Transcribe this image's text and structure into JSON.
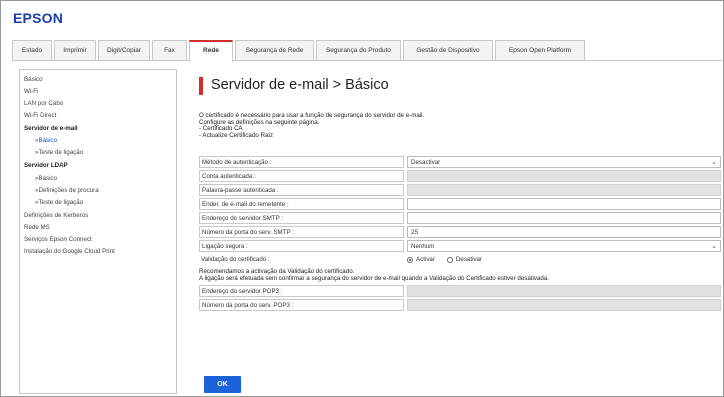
{
  "brand": {
    "logo": "EPSON"
  },
  "tabs": [
    {
      "label": "Estado"
    },
    {
      "label": "Imprimir"
    },
    {
      "label": "Digit/Copiar"
    },
    {
      "label": "Fax"
    },
    {
      "label": "Rede"
    },
    {
      "label": "Segurança de Rede"
    },
    {
      "label": "Segurança do Produto"
    },
    {
      "label": "Gestão de Dispositivo"
    },
    {
      "label": "Epson Open Platform"
    }
  ],
  "sidebar": {
    "items": [
      {
        "label": "Básico"
      },
      {
        "label": "Wi-Fi"
      },
      {
        "label": "LAN por Cabo"
      },
      {
        "label": "Wi-Fi Direct"
      },
      {
        "label": "Servidor de e-mail"
      },
      {
        "label": "»Básico"
      },
      {
        "label": "»Teste de ligação"
      },
      {
        "label": "Servidor LDAP"
      },
      {
        "label": "»Básico"
      },
      {
        "label": "»Definições de procura"
      },
      {
        "label": "»Teste de ligação"
      },
      {
        "label": "Definições de Kerberos"
      },
      {
        "label": "Rede MS"
      },
      {
        "label": "Serviços Epson Connect"
      },
      {
        "label": "Instalação do Google Cloud Print"
      }
    ]
  },
  "page": {
    "title": "Servidor de e-mail > Básico",
    "info_lines": [
      "O certificado é necessário para usar a função de segurança do servidor de e-mail.",
      "Configure as definições na seguinte página.",
      " - Certificado CA",
      " - Actualize Certificado Raiz"
    ]
  },
  "form": {
    "auth_method": {
      "label": "Método de autenticação :",
      "value": "Desactivar"
    },
    "auth_account": {
      "label": "Conta autenticada :",
      "value": ""
    },
    "auth_password": {
      "label": "Palavra-passe autenticada :",
      "value": ""
    },
    "sender_address": {
      "label": "Ender. de e-mail do remetente :",
      "value": ""
    },
    "smtp_address": {
      "label": "Endereço do servidor SMTP :",
      "value": ""
    },
    "smtp_port": {
      "label": "Número da porta do serv. SMTP :",
      "value": "25"
    },
    "secure_connection": {
      "label": "Ligação segura :",
      "value": "Nenhum"
    },
    "cert_validation": {
      "label": "Validação do certificado :",
      "options": [
        "Activar",
        "Desativar"
      ],
      "selected": "Activar"
    },
    "pop3_address": {
      "label": "Endereço do servidor POP3 :",
      "value": ""
    },
    "pop3_port": {
      "label": "Número da porta do serv. POP3 :",
      "value": ""
    }
  },
  "notice": {
    "line1": "Recomendamos a activação da Validação do certificado.",
    "line2": "A ligação será efetuada sem confirmar a segurança do servidor de e-mail quando a Validação do Certificado estiver desativada."
  },
  "actions": {
    "ok_label": "OK"
  },
  "colors": {
    "brand": "#1a3fa8",
    "accent": "#d32e2e",
    "button": "#1c62d9",
    "link": "#1a4fd6"
  }
}
